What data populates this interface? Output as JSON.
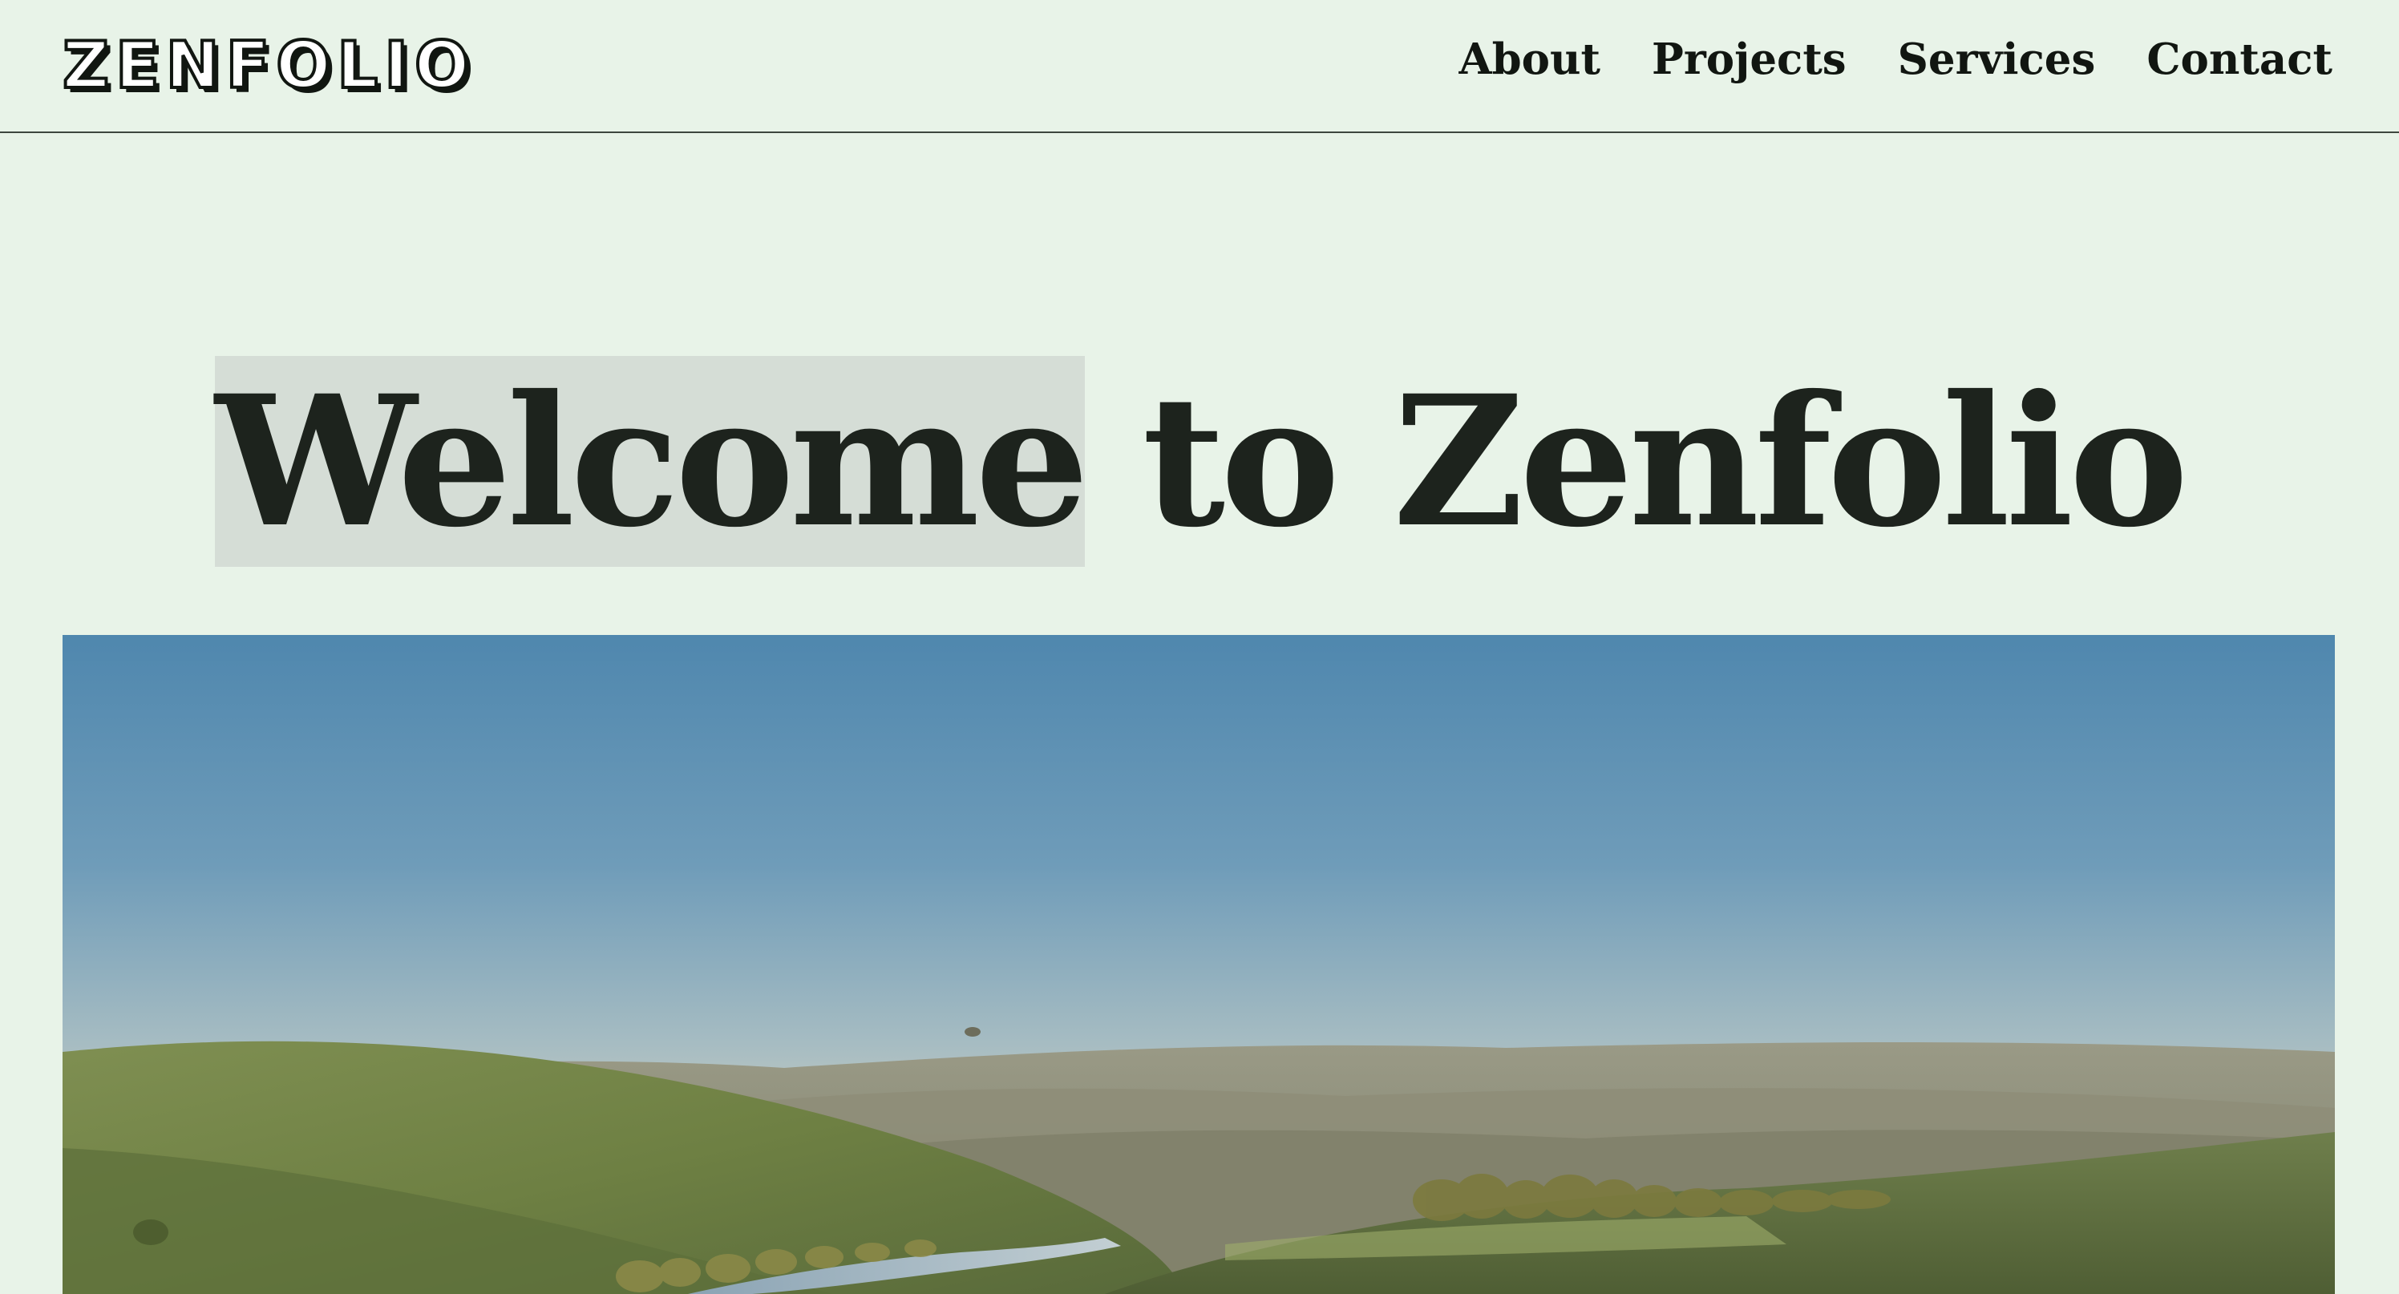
{
  "header": {
    "logo_text": "ZENFOLIO",
    "nav": [
      {
        "label": "About"
      },
      {
        "label": "Projects"
      },
      {
        "label": "Services"
      },
      {
        "label": "Contact"
      }
    ]
  },
  "hero": {
    "title_highlight": "Welcome",
    "title_rest": " to Zenfolio",
    "image_icon": "landscape-photo"
  },
  "colors": {
    "background": "#e8f3e8",
    "text": "#1d231d",
    "highlight": "#d5ddd6",
    "border": "#3d463e"
  }
}
